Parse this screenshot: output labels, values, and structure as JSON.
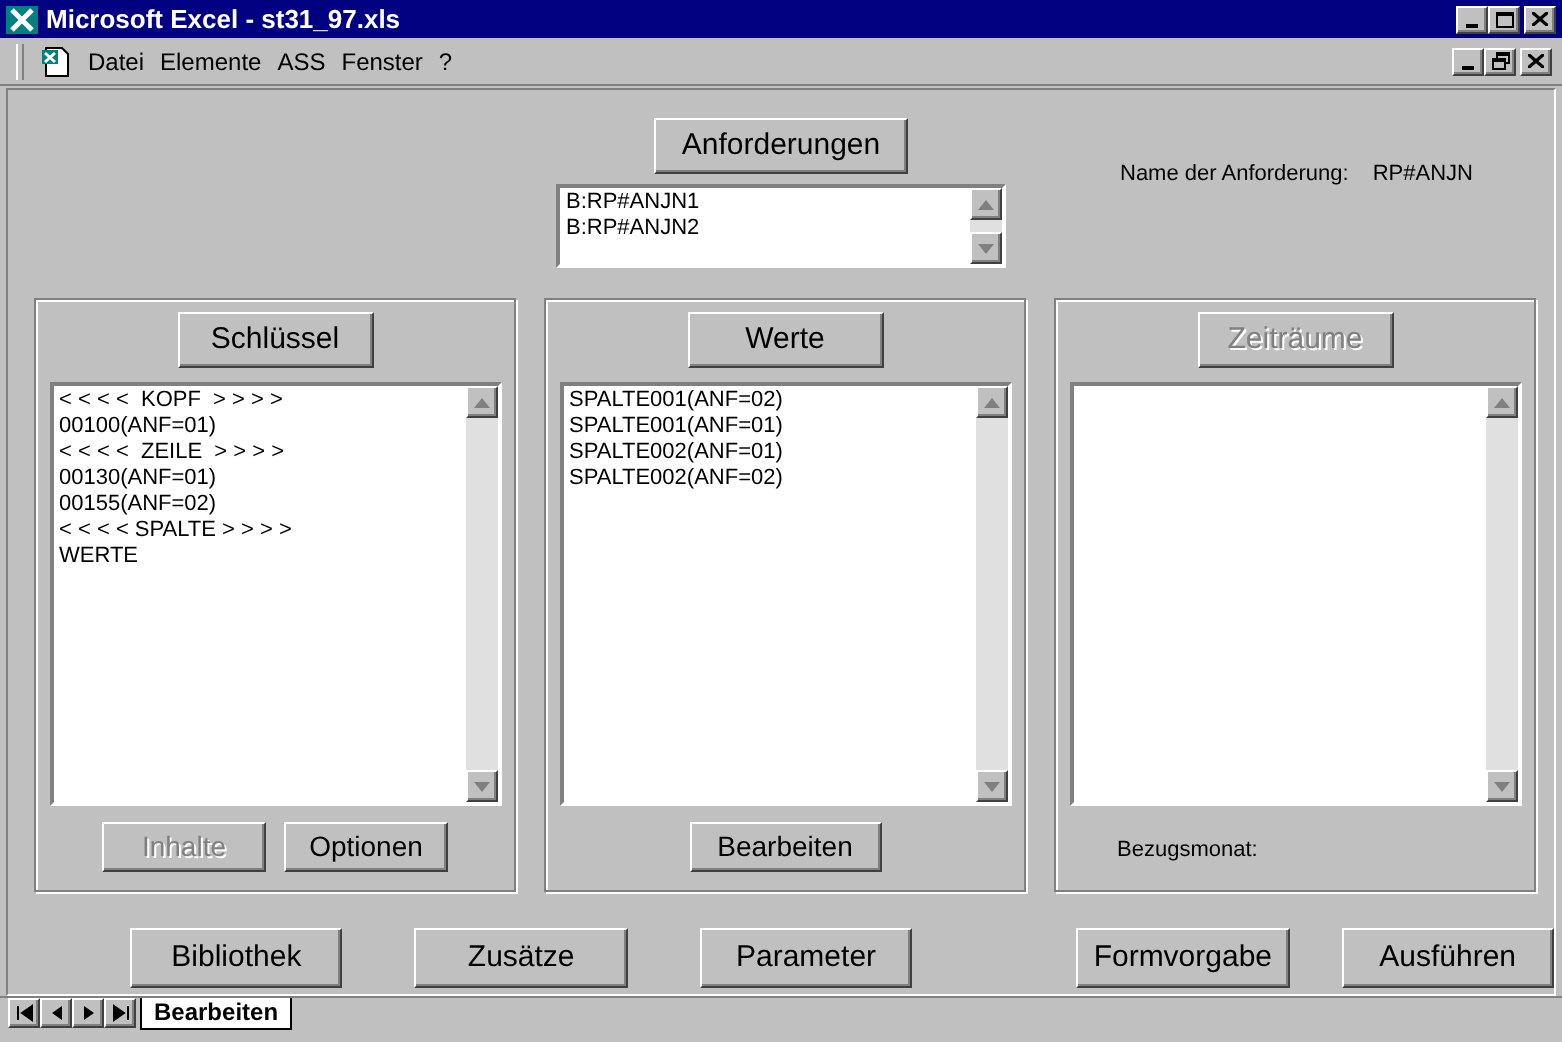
{
  "window": {
    "title": "Microsoft Excel - st31_97.xls"
  },
  "menu": [
    {
      "label": "Datei"
    },
    {
      "label": "Elemente"
    },
    {
      "label": "ASS"
    },
    {
      "label": "Fenster"
    },
    {
      "label": "?"
    }
  ],
  "requests": {
    "button": {
      "label": "Anforderungen",
      "disabled": false
    },
    "items": [
      "B:RP#ANJN1",
      "B:RP#ANJN2"
    ],
    "name_label": "Name der Anforderung:",
    "name_value": "RP#ANJN"
  },
  "panels": [
    {
      "button": {
        "label": "Schlüssel",
        "disabled": false
      },
      "items": [
        "< < < <  KOPF  > > > >",
        "00100(ANF=01)",
        "< < < <  ZEILE  > > > >",
        "00130(ANF=01)",
        "00155(ANF=02)",
        "< < < < SPALTE > > > >",
        "WERTE"
      ],
      "footer": {
        "kind": "buttons",
        "buttons": [
          {
            "label": "Inhalte",
            "disabled": true
          },
          {
            "label": "Optionen",
            "disabled": false
          }
        ]
      }
    },
    {
      "button": {
        "label": "Werte",
        "disabled": false
      },
      "items": [
        "SPALTE001(ANF=02)",
        "SPALTE001(ANF=01)",
        "SPALTE002(ANF=01)",
        "SPALTE002(ANF=02)"
      ],
      "footer": {
        "kind": "buttons",
        "buttons": [
          {
            "label": "Bearbeiten",
            "disabled": false
          }
        ]
      }
    },
    {
      "button": {
        "label": "Zeiträume",
        "disabled": true
      },
      "footer": {
        "kind": "label",
        "text": "Bezugsmonat:"
      }
    }
  ],
  "bottom_buttons": [
    {
      "label": "Bibliothek"
    },
    {
      "label": "Zusätze"
    },
    {
      "label": "Parameter"
    },
    {
      "label": "Formvorgabe"
    },
    {
      "label": "Ausführen"
    }
  ],
  "sheet_tabs": [
    {
      "label": "Bearbeiten",
      "selected": true
    }
  ]
}
